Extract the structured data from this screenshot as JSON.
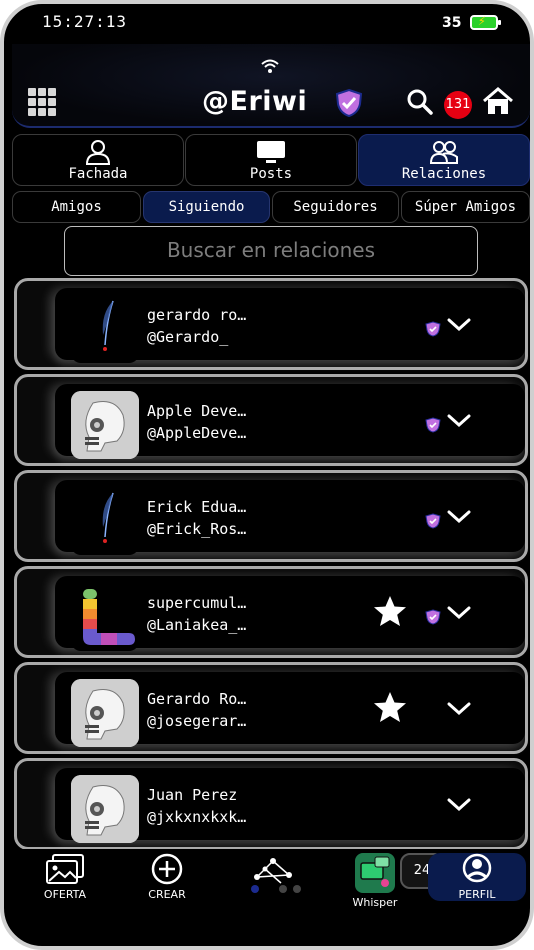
{
  "status_bar": {
    "time": "15:27:13",
    "battery": "35"
  },
  "header": {
    "title": "@Eriwi",
    "notification_count": "131"
  },
  "tabs": [
    {
      "label": "Fachada",
      "icon": "person-icon",
      "active": false
    },
    {
      "label": "Posts",
      "icon": "monitor-icon",
      "active": false
    },
    {
      "label": "Relaciones",
      "icon": "people-icon",
      "active": true
    }
  ],
  "subtabs": [
    {
      "label": "Amigos",
      "active": false
    },
    {
      "label": "Siguiendo",
      "active": true
    },
    {
      "label": "Seguidores",
      "active": false
    },
    {
      "label": "Súper Amigos",
      "active": false
    }
  ],
  "search": {
    "placeholder": "Buscar en relaciones"
  },
  "relations": [
    {
      "name": "gerardo ro…",
      "handle": "@Gerardo_",
      "avatar": "feather",
      "starred": false,
      "verified": true
    },
    {
      "name": "Apple Deve…",
      "handle": "@AppleDeve…",
      "avatar": "robot",
      "starred": false,
      "verified": true
    },
    {
      "name": "Erick Edua…",
      "handle": "@Erick_Ros…",
      "avatar": "feather",
      "starred": false,
      "verified": true
    },
    {
      "name": "supercumul…",
      "handle": "@Laniakea_…",
      "avatar": "logo",
      "starred": true,
      "verified": true
    },
    {
      "name": "Gerardo Ro…",
      "handle": "@josegerar…",
      "avatar": "robot",
      "starred": true,
      "verified": false
    },
    {
      "name": "Juan Perez",
      "handle": "@jxkxnxkxk…",
      "avatar": "robot",
      "starred": false,
      "verified": false
    }
  ],
  "bottom_nav": {
    "oferta": "OFERTA",
    "crear": "CREAR",
    "whisper": "Whisper",
    "count": "24",
    "perfil": "PERFIL"
  },
  "colors": {
    "accent": "#0a1b4d",
    "badge": "#e60012",
    "shield": "#c070e0"
  }
}
